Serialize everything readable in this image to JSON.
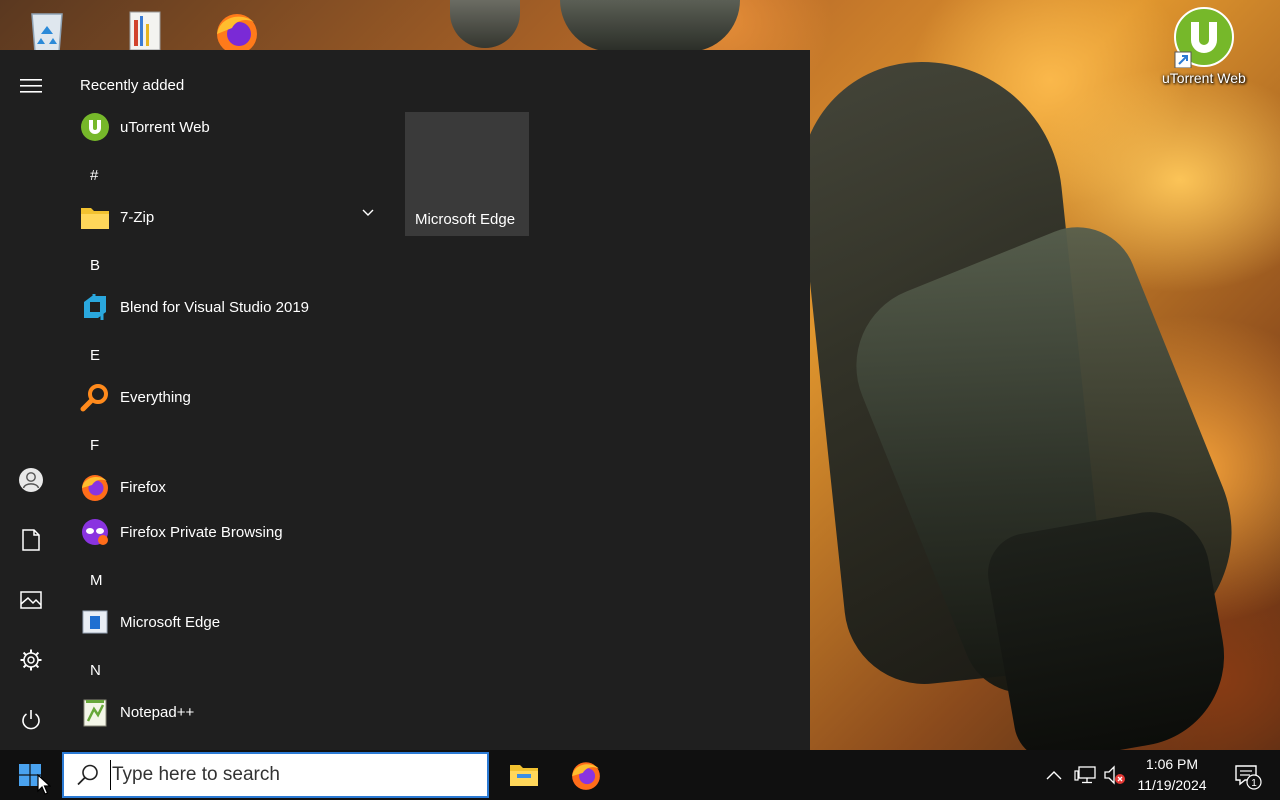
{
  "desktop": {
    "icons": [
      {
        "name": "recycle-bin-icon"
      },
      {
        "name": "notepad-shortcut-icon"
      },
      {
        "name": "firefox-icon"
      },
      {
        "name": "utorrent-icon",
        "label": "uTorrent Web"
      }
    ]
  },
  "start_menu": {
    "rail": [
      "hamburger-menu-icon",
      "user-icon",
      "documents-icon",
      "pictures-icon",
      "settings-icon",
      "power-icon"
    ],
    "header": "Recently added",
    "items": [
      {
        "type": "app",
        "label": "uTorrent Web",
        "icon": "utorrent-icon"
      },
      {
        "type": "letter",
        "label": "#"
      },
      {
        "type": "app",
        "label": "7-Zip",
        "icon": "folder-icon",
        "expandable": true
      },
      {
        "type": "letter",
        "label": "B"
      },
      {
        "type": "app",
        "label": "Blend for Visual Studio 2019",
        "icon": "blend-icon"
      },
      {
        "type": "letter",
        "label": "E"
      },
      {
        "type": "app",
        "label": "Everything",
        "icon": "search-magnifier-icon"
      },
      {
        "type": "letter",
        "label": "F"
      },
      {
        "type": "app",
        "label": "Firefox",
        "icon": "firefox-icon"
      },
      {
        "type": "app",
        "label": "Firefox Private Browsing",
        "icon": "firefox-private-icon"
      },
      {
        "type": "letter",
        "label": "M"
      },
      {
        "type": "app",
        "label": "Microsoft Edge",
        "icon": "edge-icon"
      },
      {
        "type": "letter",
        "label": "N"
      },
      {
        "type": "app",
        "label": "Notepad++",
        "icon": "notepad-plus-plus-icon"
      }
    ],
    "tile": {
      "label": "Microsoft Edge"
    }
  },
  "taskbar": {
    "search_placeholder": "Type here to search",
    "pinned": [
      "file-explorer-icon",
      "firefox-icon"
    ],
    "tray": [
      "chevron-up-icon",
      "network-icon",
      "volume-muted-icon"
    ],
    "time": "1:06 PM",
    "date": "11/19/2024",
    "notification_count": "1"
  },
  "colors": {
    "accent": "#2b7ad4",
    "menu_bg": "#1f1f1f",
    "taskbar_bg": "#101010",
    "tile_bg": "#3a3a3a"
  }
}
